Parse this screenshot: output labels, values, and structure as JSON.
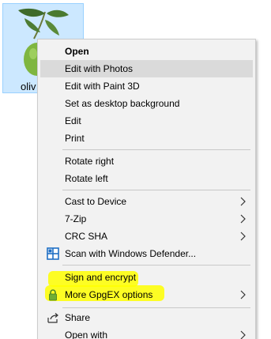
{
  "file": {
    "label": "oliv",
    "icon": "olive-image-thumbnail-icon"
  },
  "menu": {
    "items": [
      {
        "label": "Open",
        "bold": true
      },
      {
        "label": "Edit with Photos",
        "hover": true
      },
      {
        "label": "Edit with Paint 3D"
      },
      {
        "label": "Set as desktop background"
      },
      {
        "label": "Edit"
      },
      {
        "label": "Print"
      },
      {
        "label": "Rotate right"
      },
      {
        "label": "Rotate left"
      },
      {
        "label": "Cast to Device",
        "submenu": true
      },
      {
        "label": "7-Zip",
        "submenu": true
      },
      {
        "label": "CRC SHA",
        "submenu": true
      },
      {
        "label": "Scan with Windows Defender...",
        "icon": "windows-defender-icon"
      },
      {
        "label": "Sign and encrypt",
        "highlighted": true
      },
      {
        "label": "More GpgEX options",
        "icon": "gpg-lock-icon",
        "submenu": true,
        "highlighted": true
      },
      {
        "label": "Share",
        "icon": "share-icon"
      },
      {
        "label": "Open with",
        "submenu": true
      }
    ]
  },
  "colors": {
    "menu_bg": "#f2f2f2",
    "hover_bg": "#dadada",
    "highlight": "#ffff00",
    "selection_bg": "#cce8ff",
    "defender_blue": "#1f6fc5",
    "lock_green": "#5a9a2a"
  }
}
